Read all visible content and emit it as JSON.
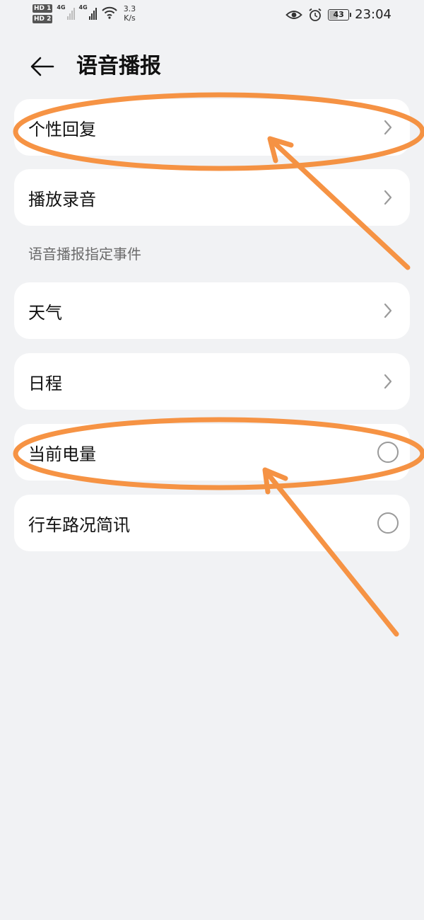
{
  "status_bar": {
    "hd1": "HD 1",
    "hd2": "HD 2",
    "net1": "4G",
    "net2": "4G",
    "speed_value": "3.3",
    "speed_unit": "K/s",
    "battery_level": "43",
    "battery_fraction": 0.43,
    "time": "23:04"
  },
  "header": {
    "title": "语音播报"
  },
  "items": [
    {
      "label": "个性回复",
      "control": "chevron"
    },
    {
      "label": "播放录音",
      "control": "chevron"
    }
  ],
  "section": {
    "title": "语音播报指定事件"
  },
  "events": [
    {
      "label": "天气",
      "control": "chevron"
    },
    {
      "label": "日程",
      "control": "chevron"
    },
    {
      "label": "当前电量",
      "control": "radio",
      "checked": false
    },
    {
      "label": "行车路况简讯",
      "control": "radio",
      "checked": false
    }
  ],
  "colors": {
    "background": "#f1f2f4",
    "card": "#ffffff",
    "annotation": "#f58d3a",
    "secondary_text": "#6b6b6b"
  },
  "icons": {
    "back": "arrow-left-icon",
    "chevron": "chevron-right-icon",
    "radio": "radio-unchecked-icon",
    "eye": "eye-icon",
    "alarm": "alarm-icon",
    "wifi": "wifi-icon"
  }
}
